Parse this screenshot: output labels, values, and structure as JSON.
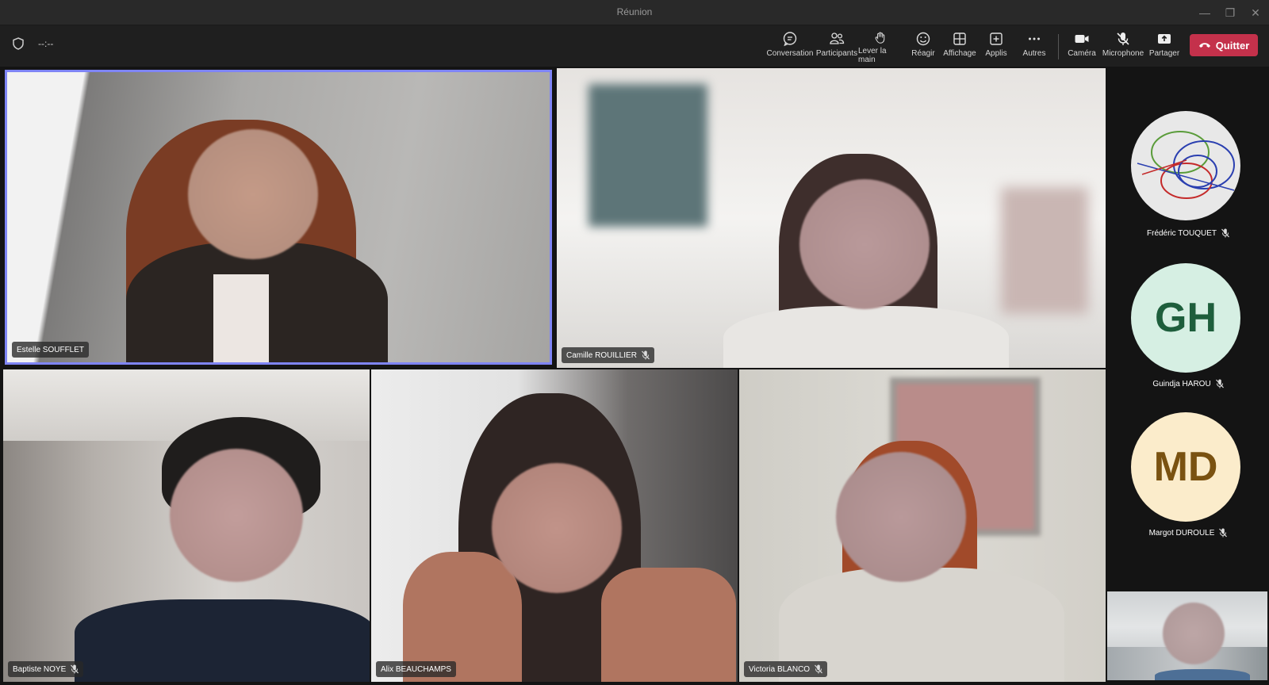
{
  "window": {
    "title": "Réunion",
    "timer": "--:--"
  },
  "toolbar": {
    "items": [
      {
        "label": "Conversation",
        "icon": "chat-icon"
      },
      {
        "label": "Participants",
        "icon": "people-icon"
      },
      {
        "label": "Lever la main",
        "icon": "raise-hand-icon"
      },
      {
        "label": "Réagir",
        "icon": "emoji-icon"
      },
      {
        "label": "Affichage",
        "icon": "grid-layout-icon"
      },
      {
        "label": "Applis",
        "icon": "add-app-icon"
      },
      {
        "label": "Autres",
        "icon": "more-icon"
      },
      {
        "label": "Caméra",
        "icon": "camera-icon"
      },
      {
        "label": "Microphone",
        "icon": "mic-off-icon"
      },
      {
        "label": "Partager",
        "icon": "share-icon"
      }
    ],
    "quit_label": "Quitter"
  },
  "grid": {
    "tiles": [
      {
        "name": "Estelle SOUFFLET",
        "muted": false,
        "active": true
      },
      {
        "name": "Camille ROUILLIER",
        "muted": true
      },
      {
        "name": "Baptiste NOYE",
        "muted": true
      },
      {
        "name": "Alix BEAUCHAMPS",
        "muted": false
      },
      {
        "name": "Victoria BLANCO",
        "muted": true
      }
    ]
  },
  "sidebar": {
    "participants": [
      {
        "name": "Frédéric TOUQUET",
        "initials": "",
        "muted": true,
        "avatar": "drawing"
      },
      {
        "name": "Guindja HAROU",
        "initials": "GH",
        "muted": true,
        "bg": "#d6efe3",
        "fg": "#1e5e3c"
      },
      {
        "name": "Margot DUROULE",
        "initials": "MD",
        "muted": true,
        "bg": "#fbeccb",
        "fg": "#7a5211"
      }
    ]
  },
  "colors": {
    "active_border": "#7f85f5",
    "quit": "#c4314b"
  }
}
